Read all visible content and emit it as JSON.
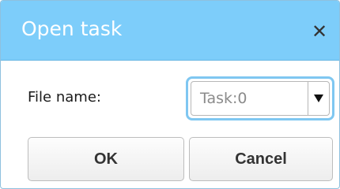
{
  "dialog": {
    "title": "Open task",
    "close_icon": "close-icon"
  },
  "form": {
    "file_name_label": "File name:",
    "selected_value": "Task:0",
    "dropdown_icon": "caret-down-icon"
  },
  "buttons": {
    "ok_label": "OK",
    "cancel_label": "Cancel"
  },
  "colors": {
    "titlebar": "#7dcdfa",
    "focus_ring": "#7fc7f1"
  }
}
